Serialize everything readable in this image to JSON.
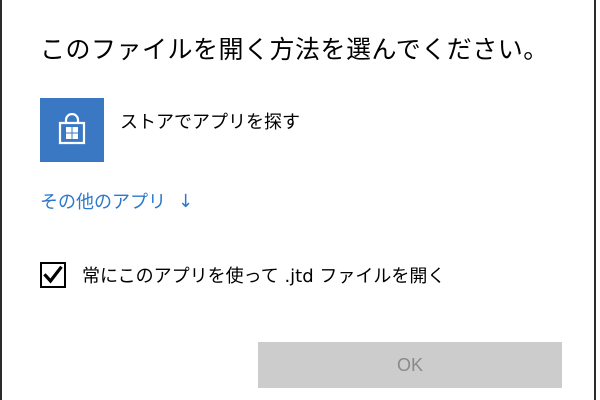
{
  "dialog": {
    "title": "このファイルを開く方法を選んでください。",
    "store_option": {
      "label": "ストアでアプリを探す",
      "icon": "store-bag-icon",
      "tile_color": "#3a78c4"
    },
    "more_apps": {
      "label": "その他のアプリ",
      "arrow": "↓",
      "color": "#2b78cc"
    },
    "always_use": {
      "label": "常にこのアプリを使って .jtd ファイルを開く",
      "checked": true
    },
    "ok_button": {
      "label": "OK",
      "enabled": false
    }
  }
}
